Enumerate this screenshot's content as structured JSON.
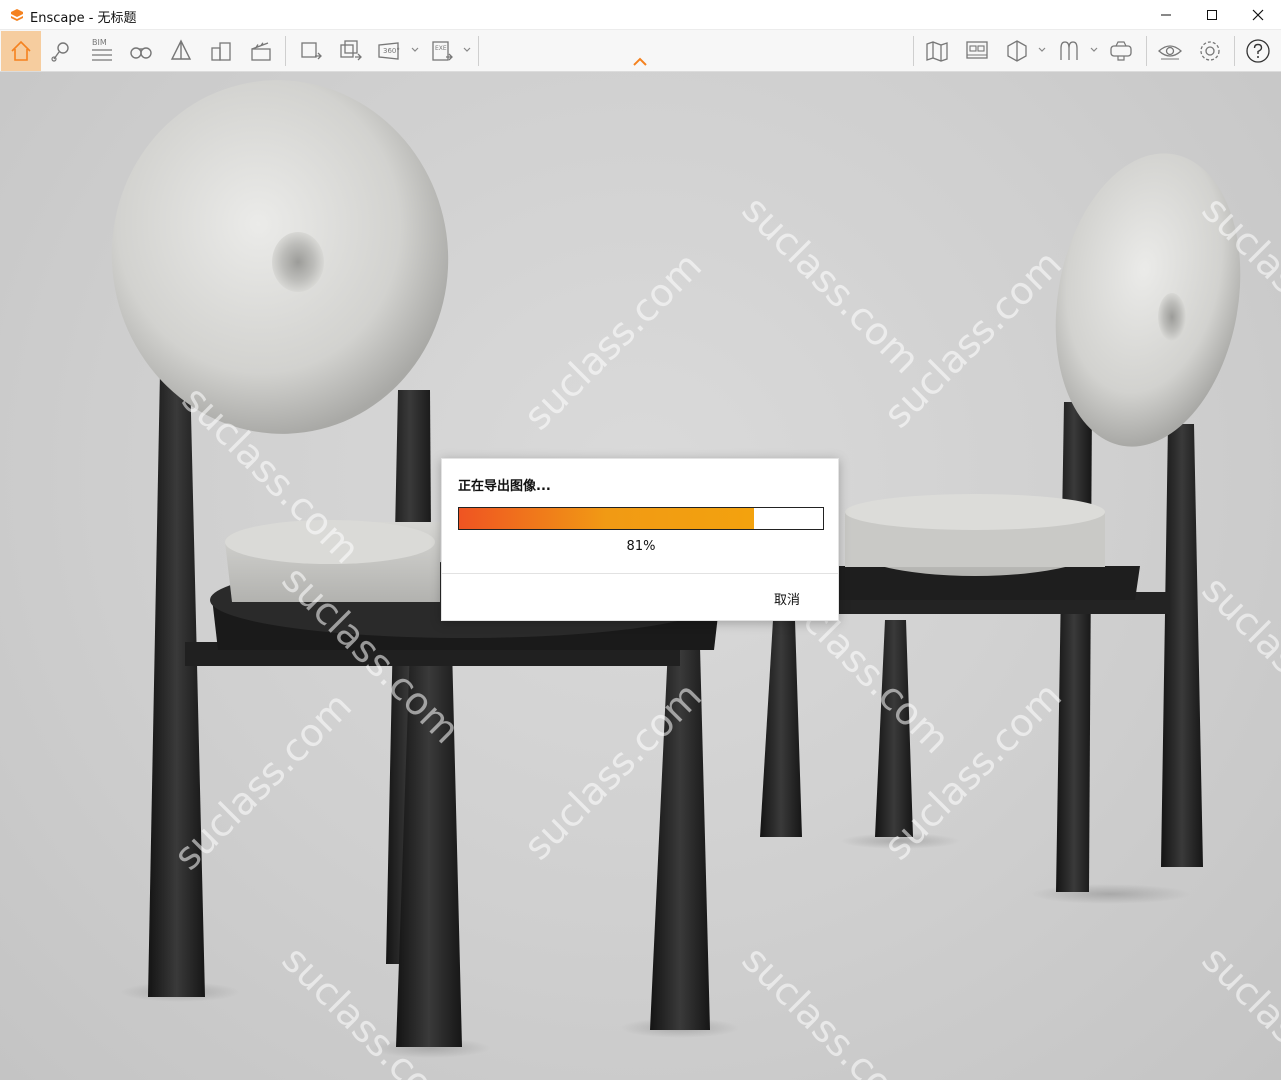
{
  "window": {
    "title": "Enscape - 无标题",
    "controls": [
      "minimize-icon",
      "maximize-icon",
      "close-icon"
    ]
  },
  "toolbar": {
    "left_icons": [
      "home-icon",
      "location-icon",
      "bim-icon",
      "binoculars-icon",
      "perspective-icon",
      "buildings-icon",
      "clapboard-icon"
    ],
    "export_icons": [
      "render-export-icon",
      "batch-export-icon",
      "panorama-360-icon",
      "exe-export-icon"
    ],
    "right_icons": [
      "map-icon",
      "views-icon",
      "cube-icon",
      "asset-library-icon",
      "vr-headset-icon",
      "eye-icon",
      "settings-icon",
      "help-icon"
    ],
    "bim_label": "BIM",
    "panorama_label": "360°",
    "exe_label": "EXE",
    "accent_color": "#f5821f",
    "active_icon": "home-icon"
  },
  "viewport": {
    "watermark": "suclass.com"
  },
  "dialog": {
    "title": "正在导出图像...",
    "progress": 0.81,
    "progress_text": "81%",
    "cancel_label": "取消"
  }
}
